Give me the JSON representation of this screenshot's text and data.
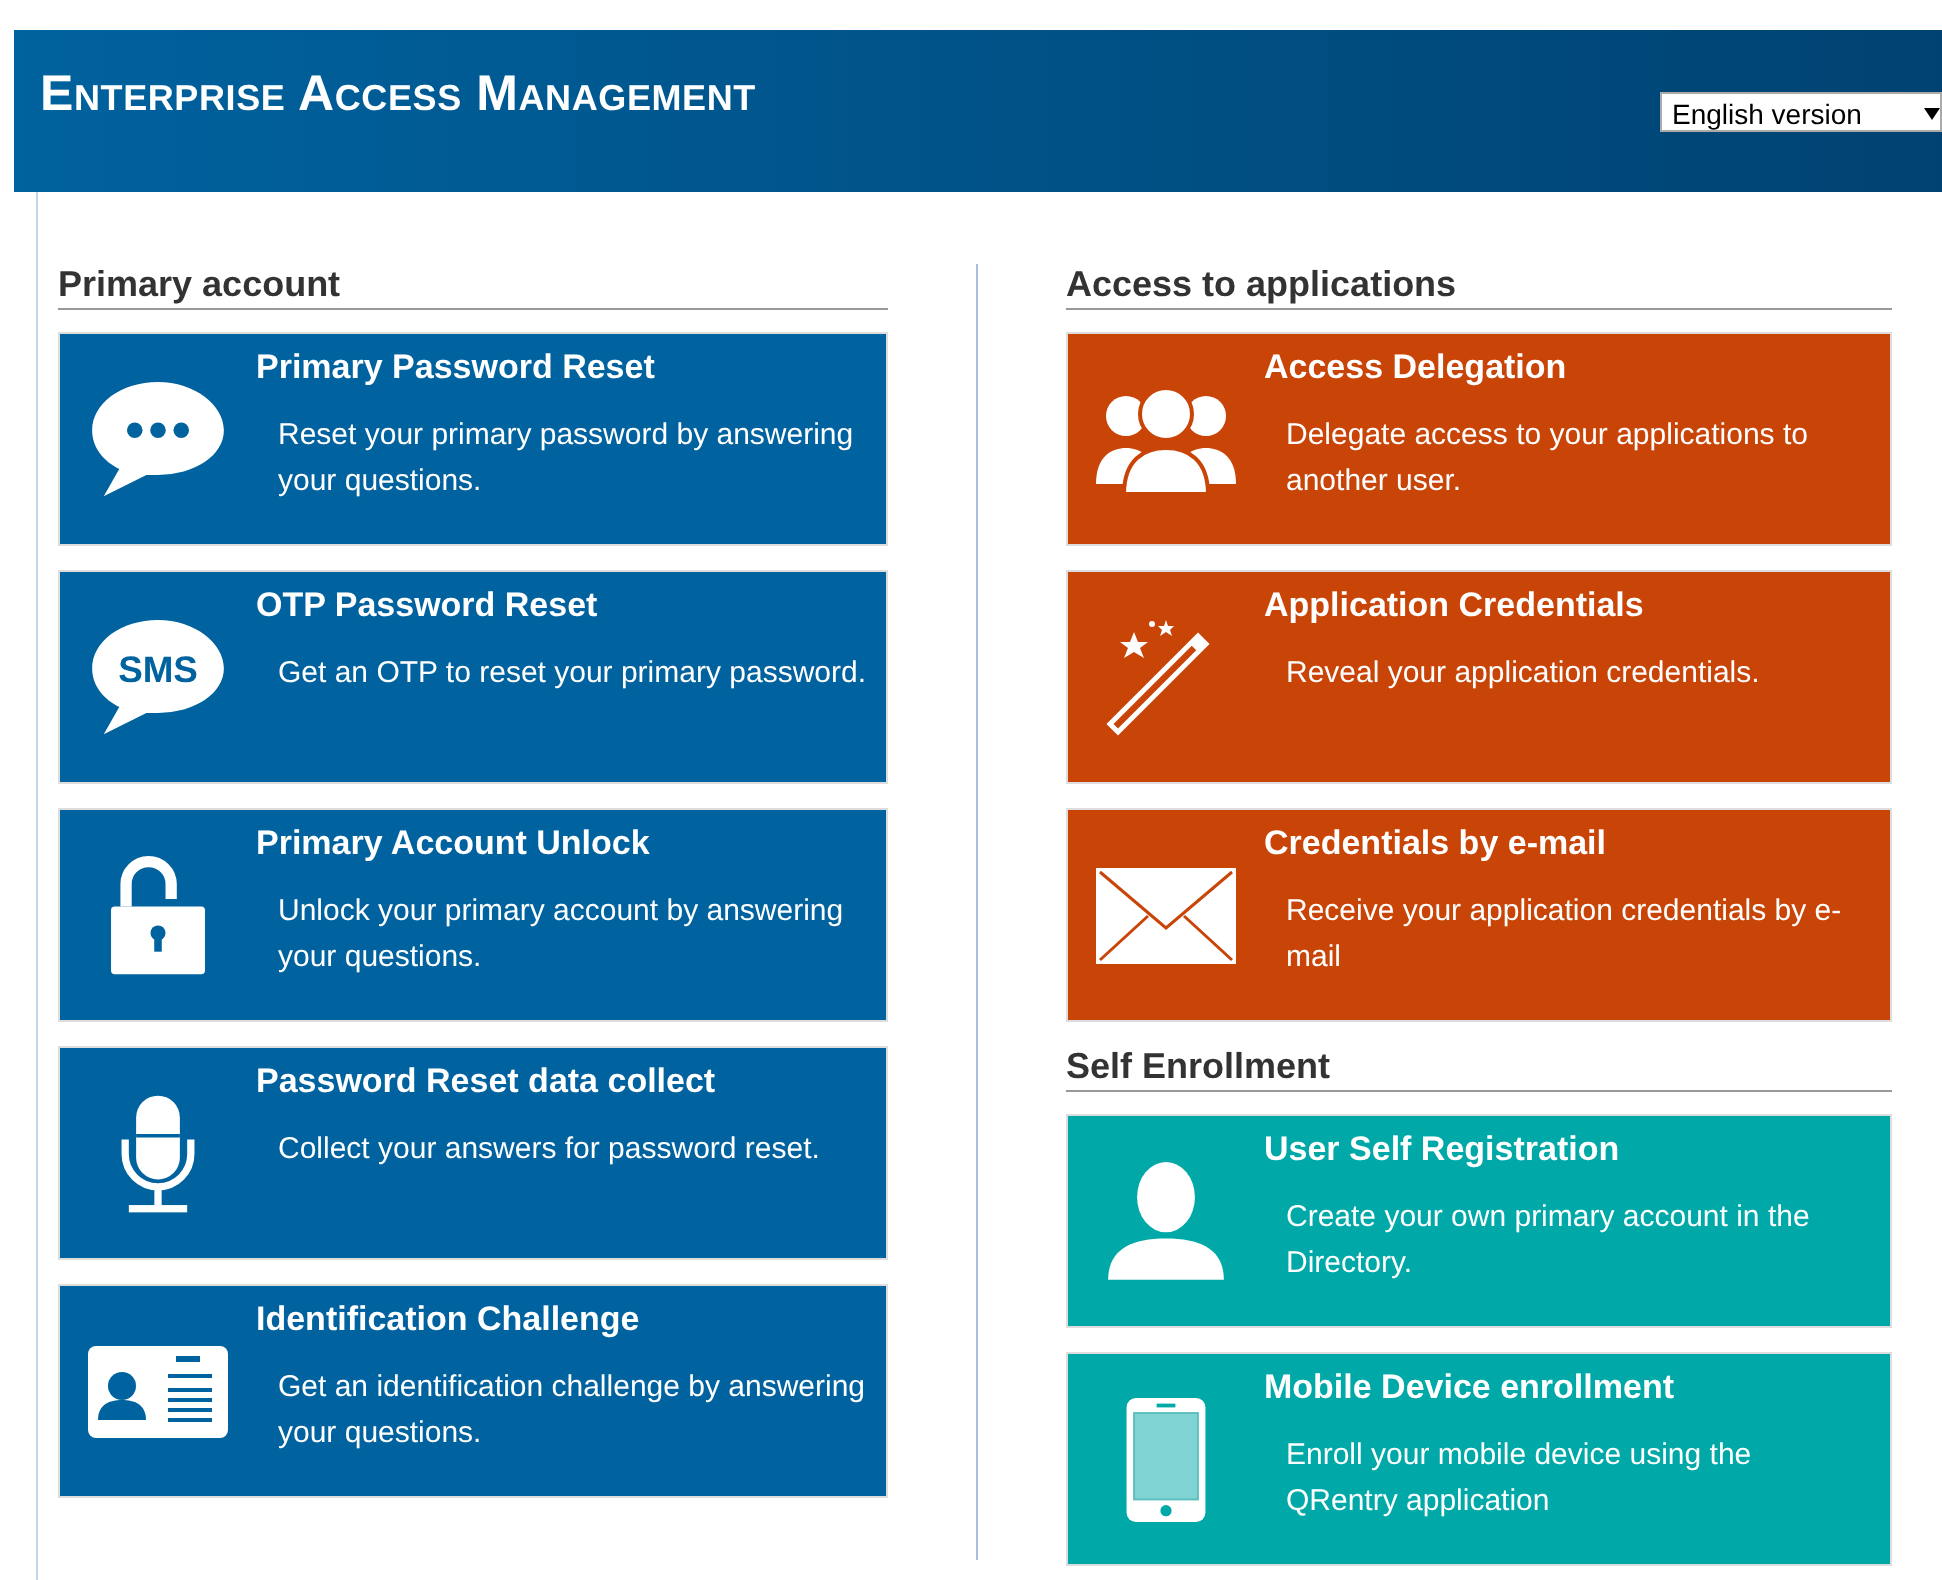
{
  "header": {
    "title": "Enterprise Access Management",
    "language": "English version"
  },
  "columns": [
    {
      "sections": [
        {
          "title": "Primary account",
          "color": "#00629e",
          "tiles": [
            {
              "kind": "chat",
              "title": "Primary Password Reset",
              "description": "Reset your primary password by answering your questions."
            },
            {
              "kind": "sms",
              "icon_text": "SMS",
              "title": "OTP Password Reset",
              "description": "Get an OTP to reset your primary password."
            },
            {
              "kind": "lock",
              "title": "Primary Account Unlock",
              "description": "Unlock your primary account by answering your questions."
            },
            {
              "kind": "mic",
              "title": "Password Reset data collect",
              "description": "Collect your answers for password reset."
            },
            {
              "kind": "idcard",
              "title": "Identification Challenge",
              "description": "Get an identification challenge by answering your questions."
            }
          ]
        }
      ]
    },
    {
      "sections": [
        {
          "title": "Access to applications",
          "color": "#c94407",
          "tiles": [
            {
              "kind": "group",
              "title": "Access Delegation",
              "description": "Delegate access to your applications to another user."
            },
            {
              "kind": "wand",
              "title": "Application Credentials",
              "description": "Reveal your application credentials."
            },
            {
              "kind": "envelope",
              "title": "Credentials by e-mail",
              "description": "Receive your application credentials by e-mail"
            }
          ]
        },
        {
          "title": "Self Enrollment",
          "color": "#00a8a8",
          "tiles": [
            {
              "kind": "person",
              "title": "User Self Registration",
              "description": "Create your own primary account in the Directory."
            },
            {
              "kind": "phone",
              "title": "Mobile Device enrollment",
              "description": "Enroll your mobile device using the QRentry application"
            }
          ]
        }
      ]
    }
  ]
}
